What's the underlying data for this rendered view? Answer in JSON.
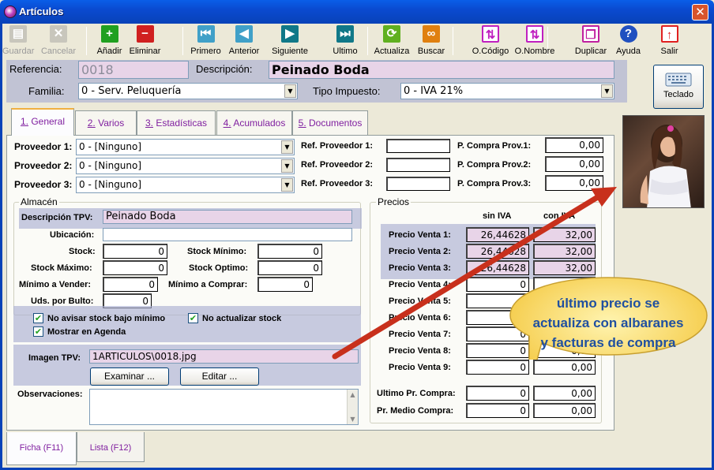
{
  "window": {
    "title": "Artículos",
    "close": "✕"
  },
  "toolbar": {
    "buttons": [
      {
        "label": "Guardar",
        "icon": "save-icon",
        "enabled": false,
        "color": "#9a9a9a"
      },
      {
        "label": "Cancelar",
        "icon": "cancel-icon",
        "enabled": false,
        "color": "#9a9a9a"
      },
      {
        "label": "Añadir",
        "icon": "add-icon",
        "color": "#20a020"
      },
      {
        "label": "Eliminar",
        "icon": "delete-icon",
        "color": "#d02020"
      },
      {
        "label": "Primero",
        "icon": "first-icon",
        "color": "#40a0c8"
      },
      {
        "label": "Anterior",
        "icon": "previous-icon",
        "color": "#40a0c8"
      },
      {
        "label": "Siguiente",
        "icon": "next-icon",
        "color": "#107888"
      },
      {
        "label": "Ultimo",
        "icon": "last-icon",
        "color": "#107888"
      },
      {
        "label": "Actualiza",
        "icon": "refresh-icon",
        "color": "#60b020"
      },
      {
        "label": "Buscar",
        "icon": "binoculars-icon",
        "color": "#e08010"
      },
      {
        "label": "O.Código",
        "icon": "sort-code-icon",
        "color": "#c020c0"
      },
      {
        "label": "O.Nombre",
        "icon": "sort-name-icon",
        "color": "#c020c0"
      },
      {
        "label": "Duplicar",
        "icon": "duplicate-icon",
        "color": "#c020a0"
      },
      {
        "label": "Ayuda",
        "icon": "help-icon",
        "color": "#2050c0"
      },
      {
        "label": "Salir",
        "icon": "exit-icon",
        "color": "#e02020"
      }
    ]
  },
  "header": {
    "referencia_label": "Referencia:",
    "referencia": "0018",
    "descripcion_label": "Descripción:",
    "descripcion": "Peinado Boda",
    "familia_label": "Familia:",
    "familia": "0 - Serv. Peluquería",
    "tipo_impuesto_label": "Tipo Impuesto:",
    "tipo_impuesto": "0 - IVA 21%",
    "teclado": "Teclado"
  },
  "tabs": [
    {
      "num": "1.",
      "label": " General"
    },
    {
      "num": "2.",
      "label": " Varios"
    },
    {
      "num": "3.",
      "label": " Estadísticas"
    },
    {
      "num": "4.",
      "label": " Acumulados"
    },
    {
      "num": "5.",
      "label": " Documentos"
    }
  ],
  "proveedores": [
    {
      "label": "Proveedor 1:",
      "value": "0 - [Ninguno]",
      "ref_label": "Ref. Proveedor 1:",
      "ref": "",
      "pc_label": "P. Compra Prov.1:",
      "pc": "0,00"
    },
    {
      "label": "Proveedor 2:",
      "value": "0 - [Ninguno]",
      "ref_label": "Ref. Proveedor 2:",
      "ref": "",
      "pc_label": "P. Compra Prov.2:",
      "pc": "0,00"
    },
    {
      "label": "Proveedor 3:",
      "value": "0 - [Ninguno]",
      "ref_label": "Ref. Proveedor 3:",
      "ref": "",
      "pc_label": "P. Compra Prov.3:",
      "pc": "0,00"
    }
  ],
  "almacen": {
    "title": "Almacén",
    "desc_tpv_label": "Descripción TPV:",
    "desc_tpv": "Peinado Boda",
    "ubicacion_label": "Ubicación:",
    "ubicacion": "",
    "stock_label": "Stock:",
    "stock": "0",
    "stock_min_label": "Stock Mínimo:",
    "stock_min": "0",
    "stock_max_label": "Stock Máximo:",
    "stock_max": "0",
    "stock_opt_label": "Stock Optimo:",
    "stock_opt": "0",
    "min_vender_label": "Mínimo a Vender:",
    "min_vender": "0",
    "min_comprar_label": "Mínimo a Comprar:",
    "min_comprar": "0",
    "uds_bulto_label": "Uds. por Bulto:",
    "uds_bulto": "0",
    "no_avisar": "No avisar stock bajo mínimo",
    "no_actualizar": "No actualizar stock",
    "mostrar_agenda": "Mostrar en Agenda",
    "imagen_label": "Imagen TPV:",
    "imagen": "1ARTICULOS\\0018.jpg",
    "examinar": "Examinar ...",
    "editar": "Editar ...",
    "observaciones_label": "Observaciones:",
    "observaciones": ""
  },
  "precios": {
    "title": "Precios",
    "sin_iva": "sin IVA",
    "con_iva": "con IVA",
    "rows": [
      {
        "label": "Precio Venta 1:",
        "sin": "26,44628",
        "con": "32,00"
      },
      {
        "label": "Precio Venta 2:",
        "sin": "26,44628",
        "con": "32,00"
      },
      {
        "label": "Precio Venta 3:",
        "sin": "26,44628",
        "con": "32,00"
      },
      {
        "label": "Precio Venta 4:",
        "sin": "0",
        "con": "0,00"
      },
      {
        "label": "Precio Venta 5:",
        "sin": "0",
        "con": "0,00"
      },
      {
        "label": "Precio Venta 6:",
        "sin": "0",
        "con": "0,00"
      },
      {
        "label": "Precio Venta 7:",
        "sin": "0",
        "con": "0,00"
      },
      {
        "label": "Precio Venta 8:",
        "sin": "0",
        "con": "0,00"
      },
      {
        "label": "Precio Venta 9:",
        "sin": "0",
        "con": "0,00"
      }
    ],
    "ultimo_label": "Ultimo Pr. Compra:",
    "ultimo_sin": "0",
    "ultimo_con": "0,00",
    "medio_label": "Pr. Medio Compra:",
    "medio_sin": "0",
    "medio_con": "0,00"
  },
  "callout": {
    "line1": "último precio se",
    "line2": "actualiza con albaranes",
    "line3": "y facturas de compra"
  },
  "bottom_tabs": {
    "ficha": "Ficha (F11)",
    "lista": "Lista (F12)"
  }
}
